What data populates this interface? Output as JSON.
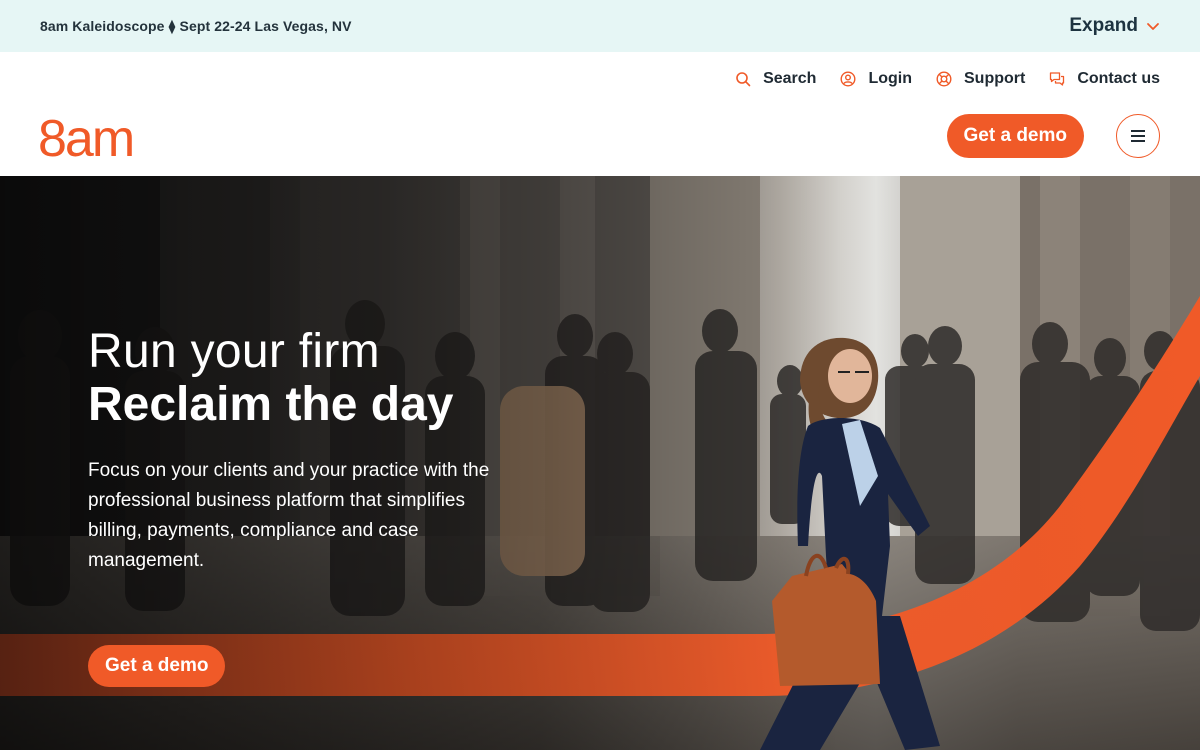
{
  "announcement": {
    "text": "8am Kaleidoscope ⧫ Sept 22-24 Las Vegas, NV",
    "expand_label": "Expand"
  },
  "utility_nav": {
    "search": "Search",
    "login": "Login",
    "support": "Support",
    "contact": "Contact us"
  },
  "logo": {
    "text": "8am"
  },
  "header": {
    "demo_label": "Get a demo"
  },
  "hero": {
    "line1": "Run your firm",
    "line2": "Reclaim the day",
    "description": "Focus on your clients and your practice with the professional business platform that simplifies billing, payments, compliance and case management.",
    "cta_label": "Get a demo"
  },
  "colors": {
    "brand": "#f05a28",
    "announcement_bg": "#e6f6f5",
    "text_dark": "#1f2a33"
  },
  "icons": {
    "expand": "chevron-down-icon",
    "search": "search-icon",
    "login": "user-icon",
    "support": "lifebuoy-icon",
    "contact": "chat-icon",
    "menu": "hamburger-icon"
  }
}
